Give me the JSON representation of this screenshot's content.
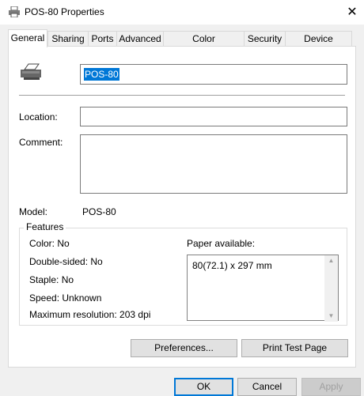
{
  "window": {
    "title": "POS-80 Properties",
    "close_glyph": "✕"
  },
  "tabs": [
    {
      "label": "General",
      "active": true
    },
    {
      "label": "Sharing"
    },
    {
      "label": "Ports"
    },
    {
      "label": "Advanced"
    },
    {
      "label": "Color Management"
    },
    {
      "label": "Security"
    },
    {
      "label": "Device Settings"
    }
  ],
  "general": {
    "printer_name": "POS-80",
    "location_label": "Location:",
    "location_value": "",
    "comment_label": "Comment:",
    "comment_value": "",
    "model_label": "Model:",
    "model_value": "POS-80"
  },
  "features": {
    "title": "Features",
    "color": "Color: No",
    "double_sided": "Double-sided: No",
    "staple": "Staple: No",
    "speed": "Speed: Unknown",
    "max_resolution": "Maximum resolution: 203 dpi",
    "paper_label": "Paper available:",
    "paper_items": [
      "80(72.1) x 297 mm"
    ]
  },
  "buttons": {
    "preferences": "Preferences...",
    "print_test_page": "Print Test Page",
    "ok": "OK",
    "cancel": "Cancel",
    "apply": "Apply"
  },
  "colors": {
    "accent": "#0078d7",
    "window_bg": "#f0f0f0",
    "panel_bg": "#ffffff"
  },
  "icons": {
    "app": "printer-icon",
    "close": "close-icon",
    "printer": "printer-icon"
  }
}
